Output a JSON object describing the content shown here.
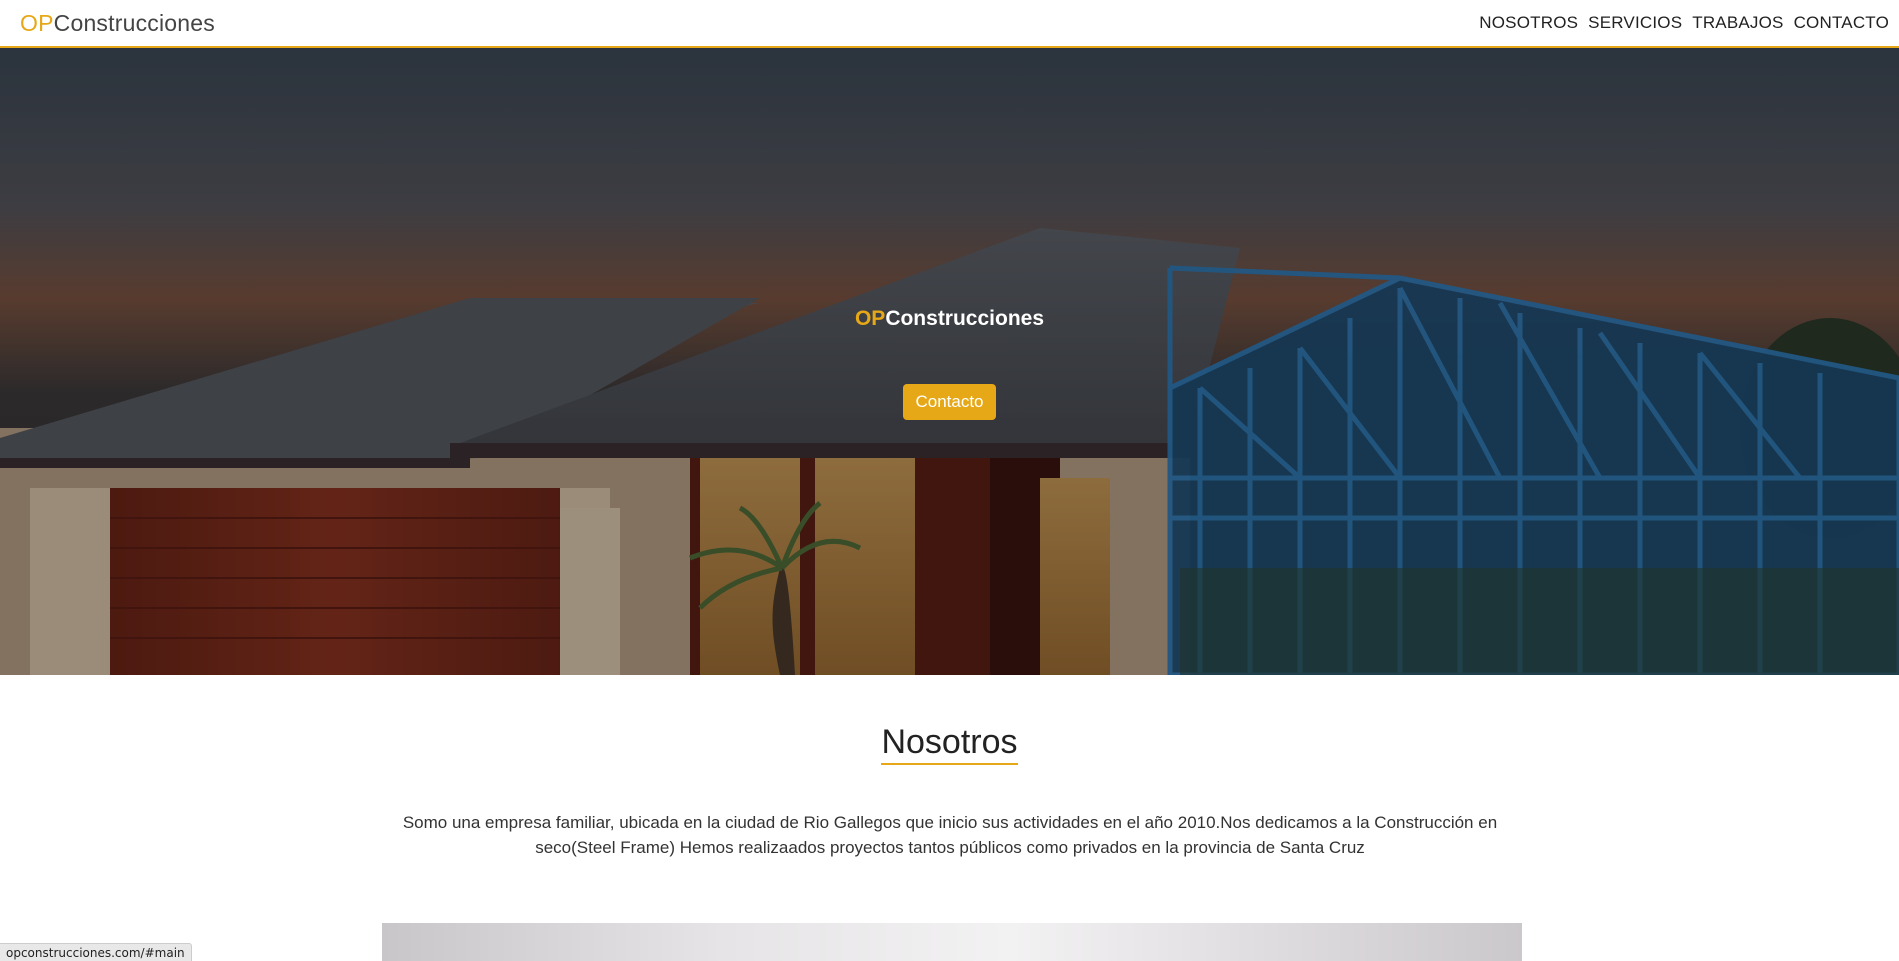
{
  "navbar": {
    "brand_prefix": "OP",
    "brand_suffix": "Construcciones",
    "links": [
      "NOSOTROS",
      "SERVICIOS",
      "TRABAJOS",
      "CONTACTO"
    ]
  },
  "hero": {
    "title_prefix": "OP",
    "title_suffix": "Construcciones",
    "button_label": "Contacto"
  },
  "about": {
    "title": "Nosotros",
    "text": "Somo una empresa familiar, ubicada en la ciudad de Rio Gallegos que inicio sus actividades en el año 2010.Nos dedicamos a la Construcción en seco(Steel Frame) Hemos realizaados proyectos tantos públicos como privados en la provincia de Santa Cruz"
  },
  "status_bar": {
    "url": "opconstrucciones.com/#main"
  },
  "colors": {
    "accent": "#e6a817",
    "steel_frame": "#2a6fa6"
  }
}
